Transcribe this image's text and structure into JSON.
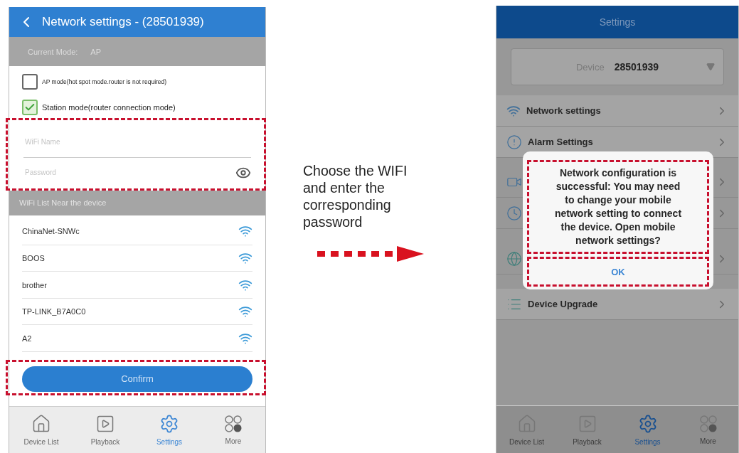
{
  "left_screen": {
    "title": "Network settings - (28501939)",
    "mode_label": "Current Mode:",
    "mode_value": "AP",
    "options": [
      {
        "label": "AP mode(hot spot mode.router is not required)",
        "checked": false
      },
      {
        "label": "Station mode(router connection mode)",
        "checked": true
      }
    ],
    "wifi_name": {
      "placeholder": "WiFi Name"
    },
    "password": {
      "placeholder": "Password"
    },
    "wifi_list_title": "WiFi List Near the device",
    "networks": [
      "ChinaNet-SNWc",
      "BOOS",
      "brother",
      "TP-LINK_B7A0C0",
      "A2"
    ],
    "confirm": "Confirm",
    "tabs": [
      {
        "label": "Device List",
        "selected": false
      },
      {
        "label": "Playback",
        "selected": false
      },
      {
        "label": "Settings",
        "selected": true
      },
      {
        "label": "More",
        "selected": false
      }
    ]
  },
  "instruction": "Choose the WIFI and enter the corresponding password",
  "right_screen": {
    "title": "Settings",
    "device_label": "Device",
    "device_value": "28501939",
    "items": [
      {
        "label": "Network settings"
      },
      {
        "label": "Alarm Settings"
      },
      {
        "label": "Device Upgrade"
      }
    ],
    "dialog": {
      "message": "Network configuration is successful: You may need to change your mobile network setting to connect the device. Open mobile network settings?",
      "button": "OK"
    },
    "tabs": [
      {
        "label": "Device List",
        "selected": false
      },
      {
        "label": "Playback",
        "selected": false
      },
      {
        "label": "Settings",
        "selected": true
      },
      {
        "label": "More",
        "selected": false
      }
    ]
  }
}
